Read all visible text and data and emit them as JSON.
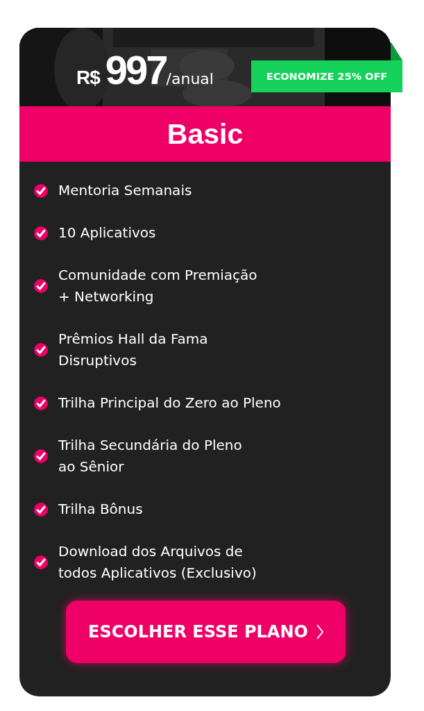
{
  "price": {
    "currency": "R$",
    "amount": "997",
    "period": "/anual"
  },
  "ribbon": "ECONOMIZE 25% OFF",
  "plan": "Basic",
  "features": [
    {
      "lines": [
        "Mentoria Semanais"
      ],
      "checked": true
    },
    {
      "lines": [
        "10 Aplicativos"
      ],
      "checked": true
    },
    {
      "lines": [
        "Comunidade com Premiação",
        "+ Networking"
      ],
      "checked": true
    },
    {
      "lines": [
        "Prêmios Hall da Fama",
        "Disruptivos"
      ],
      "checked": true
    },
    {
      "lines": [
        "Trilha Principal do Zero ao Pleno"
      ],
      "checked": true
    },
    {
      "lines": [
        "Trilha Secundária do Pleno",
        "ao Sênior"
      ],
      "checked": true
    },
    {
      "lines": [
        "Trilha Bônus"
      ],
      "checked": true
    },
    {
      "lines": [
        "Download dos Arquivos de",
        "todos Aplicativos (Exclusivo)"
      ],
      "checked": true
    }
  ],
  "button": "ESCOLHER ESSE PLANO"
}
